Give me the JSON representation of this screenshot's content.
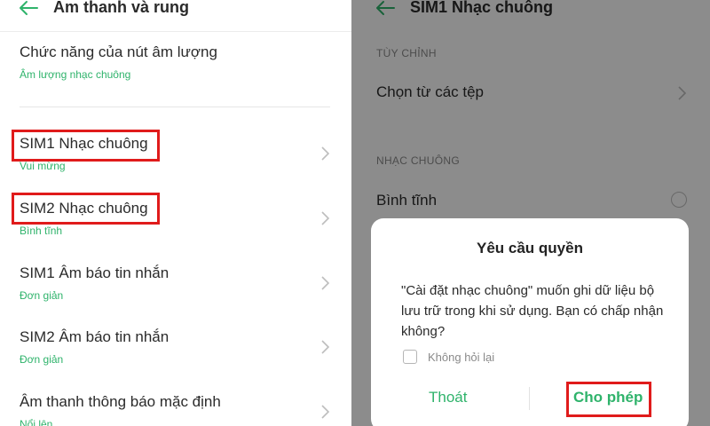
{
  "left": {
    "title": "Âm thanh và rung",
    "volume_item": {
      "title": "Chức năng của nút âm lượng",
      "subtitle": "Âm lượng nhạc chuông"
    },
    "items": [
      {
        "title": "SIM1 Nhạc chuông",
        "subtitle": "Vui mừng"
      },
      {
        "title": "SIM2 Nhạc chuông",
        "subtitle": "Bình tĩnh"
      },
      {
        "title": "SIM1 Âm báo tin nhắn",
        "subtitle": "Đơn giản"
      },
      {
        "title": "SIM2 Âm báo tin nhắn",
        "subtitle": "Đơn giản"
      },
      {
        "title": "Âm thanh thông báo mặc định",
        "subtitle": "Nổi lên"
      }
    ]
  },
  "right": {
    "title": "SIM1 Nhạc chuông",
    "section_custom": "TÙY CHỈNH",
    "choose_files": "Chọn từ các tệp",
    "section_ringtone": "NHẠC CHUÔNG",
    "ringtone_first": "Bình tĩnh",
    "dialog": {
      "title": "Yêu cầu quyền",
      "message": "\"Cài đặt nhạc chuông\" muốn ghi dữ liệu bộ lưu trữ trong khi sử dụng. Bạn có chấp nhận không?",
      "checkbox_label": "Không hỏi lại",
      "cancel": "Thoát",
      "allow": "Cho phép"
    }
  },
  "colors": {
    "accent": "#2fb36b",
    "highlight": "#e01b1b"
  }
}
